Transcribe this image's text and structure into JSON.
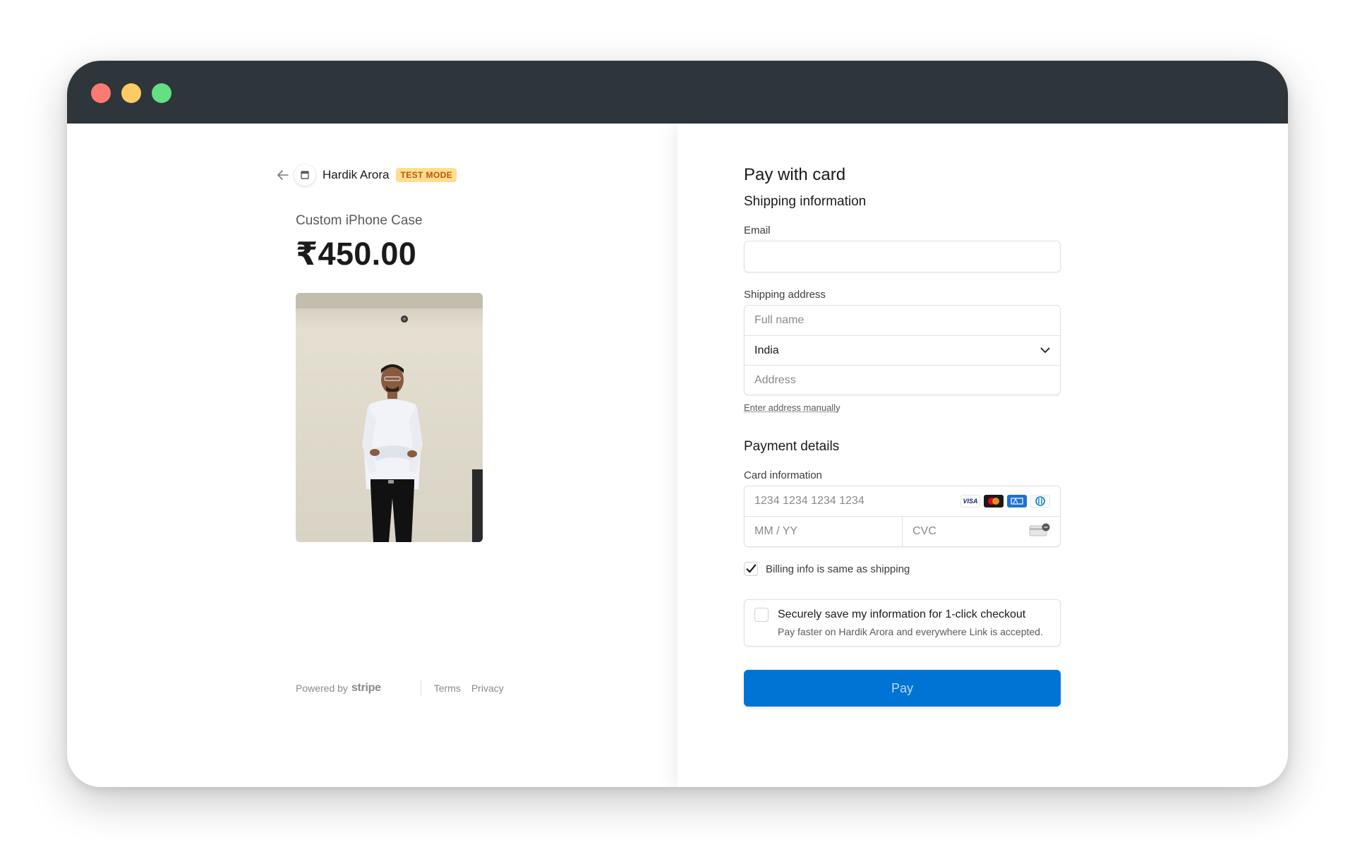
{
  "merchant": {
    "name": "Hardik Arora",
    "badge": "TEST MODE"
  },
  "product": {
    "name": "Custom iPhone Case",
    "price": "₹450.00"
  },
  "footer": {
    "powered_by": "Powered by",
    "brand": "stripe",
    "terms": "Terms",
    "privacy": "Privacy"
  },
  "form": {
    "title": "Pay with card",
    "shipping_heading": "Shipping information",
    "email_label": "Email",
    "email_value": "",
    "shipping_address_label": "Shipping address",
    "full_name_placeholder": "Full name",
    "country": "India",
    "address_placeholder": "Address",
    "manual_address_link": "Enter address manually",
    "payment_heading": "Payment details",
    "card_info_label": "Card information",
    "card_number_placeholder": "1234 1234 1234 1234",
    "expiry_placeholder": "MM / YY",
    "cvc_placeholder": "CVC",
    "card_brands": [
      "VISA",
      "mastercard",
      "amex",
      "diners"
    ],
    "billing_same_label": "Billing info is same as shipping",
    "billing_same_checked": true,
    "save_info_title": "Securely save my information for 1-click checkout",
    "save_info_subtitle": "Pay faster on Hardik Arora and everywhere Link is accepted.",
    "save_info_checked": false,
    "pay_button": "Pay"
  },
  "colors": {
    "titlebar": "#2e353b",
    "pay_button": "#0074d4",
    "badge_bg": "#ffde92",
    "badge_text": "#bb5504"
  }
}
